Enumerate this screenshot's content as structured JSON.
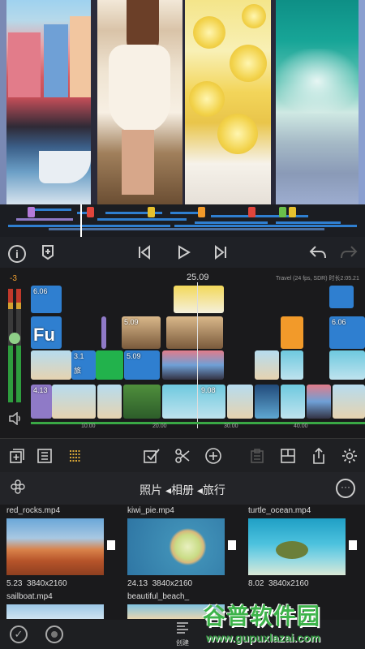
{
  "transport": {
    "info_icon": "info-icon",
    "marker_icon": "marker-icon",
    "prev_icon": "skip-back-icon",
    "play_icon": "play-icon",
    "next_icon": "skip-forward-icon",
    "undo_icon": "undo-icon",
    "redo_icon": "redo-icon"
  },
  "timeline": {
    "meter_level": "-3",
    "playhead_time": "25.09",
    "project_info": "Travel (24 fps, SDR) 时长2:05.21",
    "ruler_ticks": [
      "10.00",
      "20.00",
      "30.00",
      "40.00"
    ],
    "clips": {
      "title_duration": "6.06",
      "title_text": "Fu",
      "title_duration2": "6.06",
      "clip_a": "5.09",
      "clip_b": "5.09",
      "clip_c": "3.1",
      "clip_c_text": "旅",
      "clip_d": "4.13",
      "clip_e": "9.08"
    }
  },
  "toolbar": {
    "add_icon": "add-clip-icon",
    "list_icon": "list-icon",
    "multitrack_icon": "multitrack-icon",
    "select_icon": "checkbox-icon",
    "cut_icon": "scissors-icon",
    "insert_icon": "plus-circle-icon",
    "paste_icon": "clipboard-icon",
    "layout_icon": "layout-icon",
    "share_icon": "share-icon",
    "settings_icon": "gear-icon"
  },
  "browser": {
    "title": "照片 ◂相册 ◂旅行",
    "flower_icon": "flower-icon",
    "more_icon": "more-icon",
    "items": [
      {
        "name": "red_rocks.mp4",
        "duration": "5.23",
        "resolution": "3840x2160"
      },
      {
        "name": "kiwi_pie.mp4",
        "duration": "24.13",
        "resolution": "3840x2160"
      },
      {
        "name": "turtle_ocean.mp4",
        "duration": "8.02",
        "resolution": "3840x2160"
      },
      {
        "name": "sailboat.mp4"
      },
      {
        "name": "beautiful_beach_"
      }
    ]
  },
  "bottom": {
    "create_label": "创建"
  },
  "watermark": {
    "brand": "谷普软件园",
    "url": "www.gupuxlazai.com"
  },
  "colors": {
    "accent_blue": "#2f7fd0",
    "accent_orange": "#f29a2a",
    "accent_green": "#22b24c",
    "meter_green": "#2e9d3e"
  }
}
